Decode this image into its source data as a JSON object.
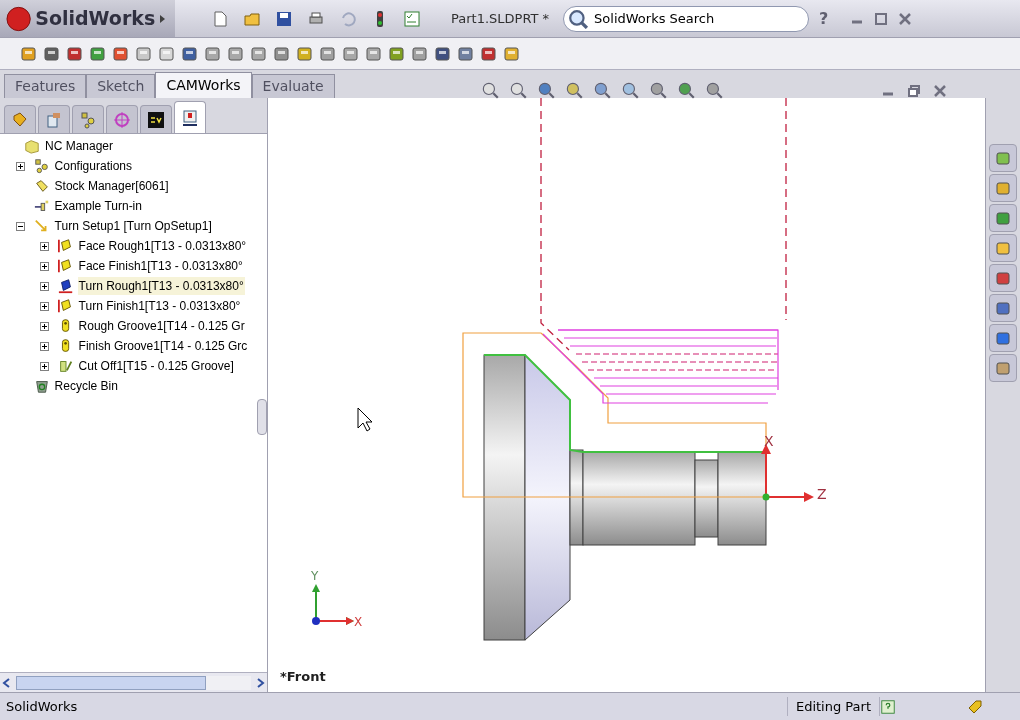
{
  "title_bar": {
    "app_name": "SolidWorks",
    "document": "Part1.SLDPRT *",
    "search": {
      "placeholder": "SolidWorks Search"
    },
    "help": "?"
  },
  "command_tabs": [
    {
      "label": "Features",
      "selected": false
    },
    {
      "label": "Sketch",
      "selected": false
    },
    {
      "label": "CAMWorks",
      "selected": true
    },
    {
      "label": "Evaluate",
      "selected": false
    }
  ],
  "panel_tabs": [
    {
      "kind": "feature",
      "selected": false
    },
    {
      "kind": "property",
      "selected": false
    },
    {
      "kind": "config",
      "selected": false
    },
    {
      "kind": "target",
      "selected": false
    },
    {
      "kind": "cw",
      "selected": false
    },
    {
      "kind": "nc",
      "selected": true
    }
  ],
  "tree": {
    "label": "NC Manager",
    "kind": "root",
    "children": [
      {
        "label": "Configurations",
        "kind": "config",
        "expanded": false,
        "selected": false
      },
      {
        "label": "Stock Manager[6061]",
        "kind": "stock",
        "selected": false
      },
      {
        "label": "Example Turn-in",
        "kind": "machine",
        "selected": false
      },
      {
        "label": "Turn Setup1 [Turn OpSetup1]",
        "kind": "setup",
        "expanded": true,
        "selected": false,
        "children": [
          {
            "label": "Face Rough1[T13 - 0.0313x80°",
            "kind": "face",
            "expanded": false,
            "selected": false
          },
          {
            "label": "Face Finish1[T13 - 0.0313x80°",
            "kind": "face",
            "expanded": false,
            "selected": false
          },
          {
            "label": "Turn Rough1[T13 - 0.0313x80°",
            "kind": "turn",
            "expanded": false,
            "selected": true
          },
          {
            "label": "Turn Finish1[T13 - 0.0313x80°",
            "kind": "face",
            "expanded": false,
            "selected": false
          },
          {
            "label": "Rough Groove1[T14 - 0.125 Gr",
            "kind": "groove",
            "expanded": false,
            "selected": false
          },
          {
            "label": "Finish Groove1[T14 - 0.125 Grc",
            "kind": "groove",
            "expanded": false,
            "selected": false
          },
          {
            "label": "Cut Off1[T15 - 0.125 Groove]",
            "kind": "cutoff",
            "expanded": false,
            "selected": false
          }
        ]
      },
      {
        "label": "Recycle Bin",
        "kind": "recycle",
        "selected": false
      }
    ]
  },
  "viewport": {
    "view_name": "*Front",
    "part_axes": {
      "vertical": "X",
      "horizontal": "Z"
    },
    "triad": {
      "vertical": "Y",
      "horizontal": "X"
    }
  },
  "status_bar": {
    "app": "SolidWorks",
    "mode": "Editing Part"
  }
}
